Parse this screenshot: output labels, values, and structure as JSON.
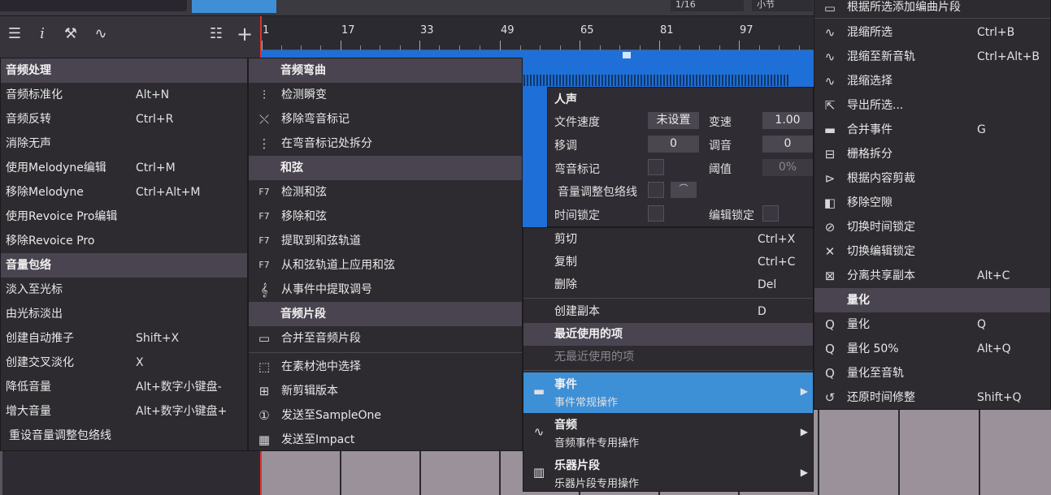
{
  "topbar": {
    "grid_value": "1/16",
    "unit_value": "小节"
  },
  "ruler": {
    "ticks": [
      "1",
      "17",
      "33",
      "49",
      "65",
      "81",
      "97"
    ]
  },
  "audio_menu": {
    "sections": [
      {
        "header": "音频处理",
        "items": [
          {
            "label": "音频标准化",
            "shortcut": "Alt+N"
          },
          {
            "label": "音频反转",
            "shortcut": "Ctrl+R"
          },
          {
            "label": "消除无声",
            "shortcut": ""
          },
          {
            "label": "使用Melodyne编辑",
            "shortcut": "Ctrl+M"
          },
          {
            "label": "移除Melodyne",
            "shortcut": "Ctrl+Alt+M"
          },
          {
            "label": "使用Revoice Pro编辑",
            "shortcut": ""
          },
          {
            "label": "移除Revoice Pro",
            "shortcut": ""
          }
        ]
      },
      {
        "header": "音量包络",
        "items": [
          {
            "label": "淡入至光标",
            "shortcut": ""
          },
          {
            "label": "由光标淡出",
            "shortcut": ""
          },
          {
            "label": "创建自动推子",
            "shortcut": "Shift+X"
          },
          {
            "label": "创建交叉淡化",
            "shortcut": "X"
          },
          {
            "label": "降低音量",
            "shortcut": "Alt+数字小键盘-"
          },
          {
            "label": "增大音量",
            "shortcut": "Alt+数字小键盘+"
          },
          {
            "label": "重设音量调整包络线",
            "shortcut": ""
          }
        ]
      }
    ]
  },
  "bend_menu": {
    "h1": "音频弯曲",
    "i1": "检测瞬变",
    "i2": "移除弯音标记",
    "i3": "在弯音标记处拆分",
    "h2": "和弦",
    "i4": "检测和弦",
    "i5": "移除和弦",
    "i6": "提取到和弦轨道",
    "i7": "从和弦轨道上应用和弦",
    "i8": "从事件中提取调号",
    "h3": "音频片段",
    "i9": "合并至音频片段",
    "i10": "在素材池中选择",
    "i11": "新剪辑版本",
    "i12": "发送至SampleOne",
    "i13": "发送至Impact",
    "icon_f7": "F7"
  },
  "props": {
    "title": "人声",
    "file_tempo_label": "文件速度",
    "file_tempo_value": "未设置",
    "speed_label": "变速",
    "speed_value": "1.00",
    "transpose_label": "移调",
    "transpose_value": "0",
    "tune_label": "调音",
    "tune_value": "0",
    "bend_markers_label": "弯音标记",
    "threshold_label": "阈值",
    "threshold_value": "0%",
    "envelope_label": "音量调整包络线",
    "time_lock_label": "时间锁定",
    "edit_lock_label": "编辑锁定"
  },
  "context_menu": {
    "cut": "剪切",
    "cut_sc": "Ctrl+X",
    "copy": "复制",
    "copy_sc": "Ctrl+C",
    "delete": "删除",
    "delete_sc": "Del",
    "duplicate": "创建副本",
    "duplicate_sc": "D",
    "recent_header": "最近使用的项",
    "recent_none": "无最近使用的项",
    "events_title": "事件",
    "events_sub": "事件常规操作",
    "audio_title": "音频",
    "audio_sub": "音频事件专用操作",
    "instr_title": "乐器片段",
    "instr_sub": "乐器片段专用操作"
  },
  "events_menu": {
    "items": [
      {
        "label": "根据所选添加编曲片段",
        "shortcut": ""
      },
      {
        "label": "混缩所选",
        "shortcut": "Ctrl+B"
      },
      {
        "label": "混缩至新音轨",
        "shortcut": "Ctrl+Alt+B"
      },
      {
        "label": "混缩选择",
        "shortcut": ""
      },
      {
        "label": "导出所选...",
        "shortcut": ""
      },
      {
        "label": "合并事件",
        "shortcut": "G"
      },
      {
        "label": "栅格拆分",
        "shortcut": ""
      },
      {
        "label": "根据内容剪裁",
        "shortcut": ""
      },
      {
        "label": "移除空隙",
        "shortcut": ""
      },
      {
        "label": "切换时间锁定",
        "shortcut": ""
      },
      {
        "label": "切换编辑锁定",
        "shortcut": ""
      },
      {
        "label": "分离共享副本",
        "shortcut": "Alt+C"
      }
    ],
    "quant_header": "量化",
    "quant_items": [
      {
        "label": "量化",
        "shortcut": "Q"
      },
      {
        "label": "量化 50%",
        "shortcut": "Alt+Q"
      },
      {
        "label": "量化至音轨",
        "shortcut": ""
      },
      {
        "label": "还原时间修整",
        "shortcut": "Shift+Q"
      }
    ]
  }
}
